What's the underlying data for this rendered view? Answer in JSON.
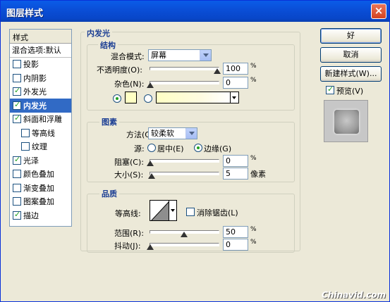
{
  "window": {
    "title": "图层样式",
    "close": "×"
  },
  "stylelist": {
    "header": "样式",
    "blend_options": "混合选项:默认",
    "items": [
      {
        "label": "投影",
        "checked": false,
        "selected": false,
        "sub": false
      },
      {
        "label": "内阴影",
        "checked": false,
        "selected": false,
        "sub": false
      },
      {
        "label": "外发光",
        "checked": true,
        "selected": false,
        "sub": false
      },
      {
        "label": "内发光",
        "checked": true,
        "selected": true,
        "sub": false
      },
      {
        "label": "斜面和浮雕",
        "checked": true,
        "selected": false,
        "sub": false
      },
      {
        "label": "等高线",
        "checked": false,
        "selected": false,
        "sub": true
      },
      {
        "label": "纹理",
        "checked": false,
        "selected": false,
        "sub": true
      },
      {
        "label": "光泽",
        "checked": true,
        "selected": false,
        "sub": false
      },
      {
        "label": "颜色叠加",
        "checked": false,
        "selected": false,
        "sub": false
      },
      {
        "label": "渐变叠加",
        "checked": false,
        "selected": false,
        "sub": false
      },
      {
        "label": "图案叠加",
        "checked": false,
        "selected": false,
        "sub": false
      },
      {
        "label": "描边",
        "checked": true,
        "selected": false,
        "sub": false
      }
    ]
  },
  "inner_glow": {
    "title": "内发光",
    "structure": {
      "title": "结构",
      "blend_mode_label": "混合模式:",
      "blend_mode_value": "屏幕",
      "opacity_label": "不透明度(O):",
      "opacity_value": "100",
      "opacity_unit": "%",
      "opacity_fraction": 1.0,
      "noise_label": "杂色(N):",
      "noise_value": "0",
      "noise_unit": "%",
      "noise_fraction": 0.0,
      "glow_color": "#ffffc4"
    },
    "elements": {
      "title": "图素",
      "method_label": "方法(Q):",
      "method_value": "较柔软",
      "source_label": "源:",
      "source_center": "居中(E)",
      "source_edge": "边缘(G)",
      "choke_label": "阻塞(C):",
      "choke_value": "0",
      "choke_unit": "%",
      "choke_fraction": 0.0,
      "size_label": "大小(S):",
      "size_value": "5",
      "size_unit": "像素",
      "size_fraction": 0.02
    },
    "quality": {
      "title": "品质",
      "contour_label": "等高线:",
      "antialias_label": "消除锯齿(L)",
      "range_label": "范围(R):",
      "range_value": "50",
      "range_unit": "%",
      "range_fraction": 0.5,
      "jitter_label": "抖动(J):",
      "jitter_value": "0",
      "jitter_unit": "%",
      "jitter_fraction": 0.0
    }
  },
  "buttons": {
    "ok": "好",
    "cancel": "取消",
    "new_style": "新建样式(W)...",
    "preview": "预览(V)"
  },
  "watermark": "Chinavid.com"
}
